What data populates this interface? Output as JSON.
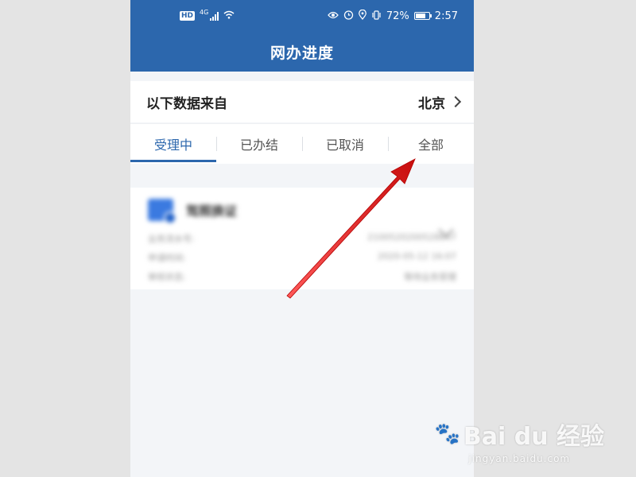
{
  "status_bar": {
    "hd": "HD",
    "network": "4G",
    "battery_percent": "72%",
    "battery_level": 0.72,
    "time": "2:57",
    "icons": [
      "eye-icon",
      "alarm-icon",
      "location-icon",
      "vibrate-icon",
      "battery-icon"
    ]
  },
  "header": {
    "title": "网办进度"
  },
  "source": {
    "label": "以下数据来自",
    "city": "北京"
  },
  "tabs": [
    {
      "label": "受理中",
      "active": true
    },
    {
      "label": "已办结",
      "active": false
    },
    {
      "label": "已取消",
      "active": false
    },
    {
      "label": "全部",
      "active": false
    }
  ],
  "card": {
    "title": "驾照换证",
    "rows": [
      {
        "label": "业务流水号:",
        "value": "2100520200528847"
      },
      {
        "label": "申请时间:",
        "value": "2020-05-12 16:07"
      },
      {
        "label": "审核状态:",
        "value": "等待业务受理"
      }
    ]
  },
  "watermark": {
    "brand": "Bai du 经验",
    "url": "jingyan.baidu.com"
  },
  "colors": {
    "primary": "#2c67ad",
    "annotation_arrow": "#e21a1a"
  }
}
